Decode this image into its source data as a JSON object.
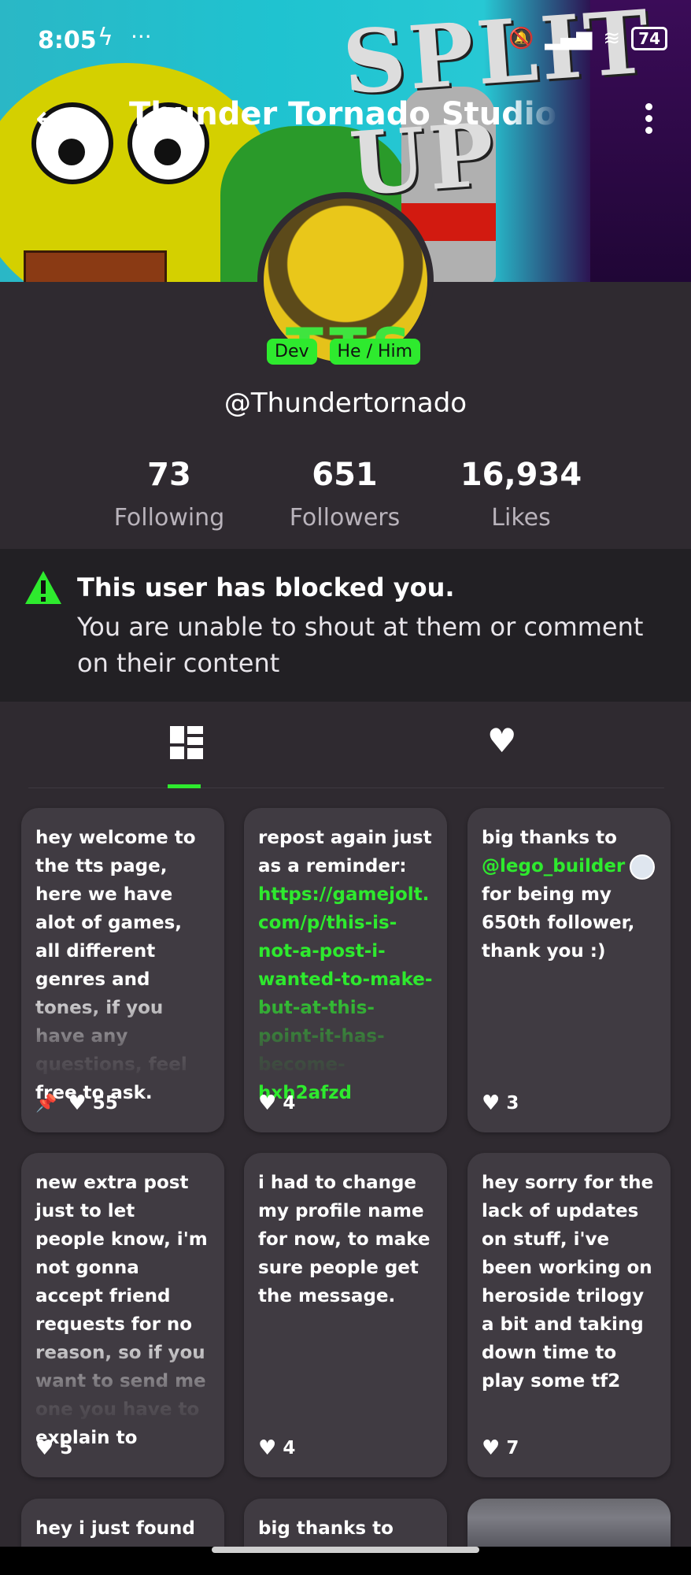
{
  "status_bar": {
    "time": "8:05",
    "battery": "74"
  },
  "header": {
    "title": "Thunder Tornado Studios (I",
    "banner_text": "SPLIT UP"
  },
  "profile": {
    "avatar_text": "TTS",
    "tags": [
      "Dev",
      "He / Him"
    ],
    "handle": "@Thundertornado"
  },
  "stats": [
    {
      "value": "73",
      "label": "Following"
    },
    {
      "value": "651",
      "label": "Followers"
    },
    {
      "value": "16,934",
      "label": "Likes"
    }
  ],
  "blocked": {
    "title": "This user has blocked you.",
    "message": "You are unable to shout at them or comment on their content"
  },
  "tabs": [
    {
      "icon": "grid-icon",
      "active": true
    },
    {
      "icon": "heart-icon",
      "active": false
    }
  ],
  "posts": [
    {
      "text": "hey welcome to the tts page, here we have alot of games, all different genres and tones, if you have any questions, feel free to ask.",
      "likes": "55",
      "pinned": true
    },
    {
      "text_prefix": "repost again just as a reminder: ",
      "link": "https://gamejolt.com/p/this-is-not-a-post-i-wanted-to-make-but-at-this-point-it-has-become-hxh2afzd",
      "likes": "4"
    },
    {
      "text_prefix": "big thanks to ",
      "mention": "@lego_builder",
      "text_suffix": " for being my 650th follower, thank you :)",
      "likes": "3"
    },
    {
      "text": "new extra post just to let people know, i'm not gonna accept friend requests for no reason, so if you want to send me one you have to explain to",
      "likes": "5"
    },
    {
      "text": "i had to change my profile name for now, to make sure people get the message.",
      "likes": "4"
    },
    {
      "text": "hey sorry for the lack of updates on stuff, i've been working on heroside trilogy a bit and taking down time to play some tf2",
      "likes": "7"
    },
    {
      "text": "hey i just found out today that"
    },
    {
      "text": "big thanks to"
    }
  ],
  "colors": {
    "accent": "#2eea2e",
    "background": "#2f2a30",
    "card": "#403b42",
    "notice_bg": "#222024"
  }
}
